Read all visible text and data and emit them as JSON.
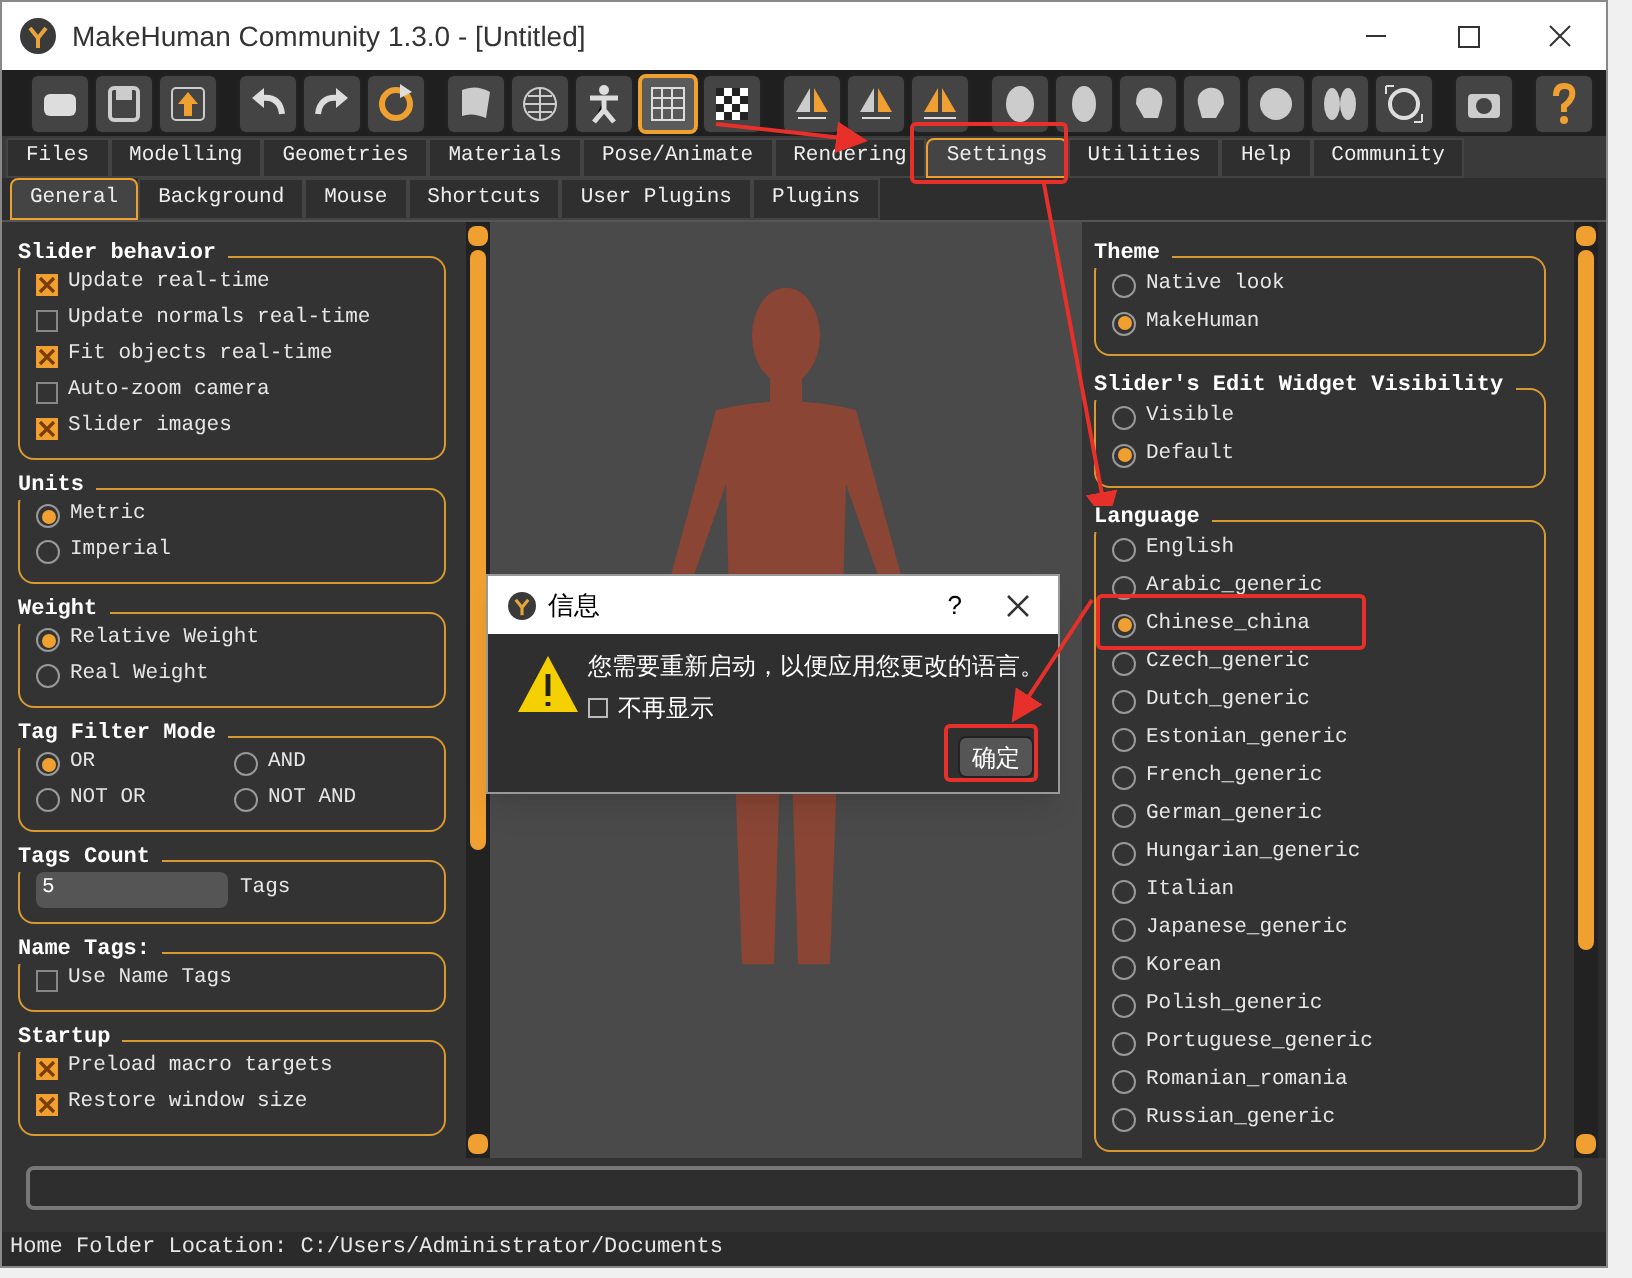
{
  "window": {
    "title": "MakeHuman Community 1.3.0 - [Untitled]"
  },
  "toolbar_buttons": [
    {
      "selected": false
    },
    {
      "selected": false
    },
    {
      "selected": false
    },
    {
      "selected": false
    },
    {
      "selected": false
    },
    {
      "selected": false
    },
    {
      "selected": false
    },
    {
      "selected": false
    },
    {
      "selected": false
    },
    {
      "selected": true
    },
    {
      "selected": false
    },
    {
      "selected": false
    },
    {
      "selected": false
    },
    {
      "selected": false
    },
    {
      "selected": false
    },
    {
      "selected": false
    },
    {
      "selected": false
    },
    {
      "selected": false
    },
    {
      "selected": false
    },
    {
      "selected": false
    },
    {
      "selected": false
    },
    {
      "selected": false
    },
    {
      "selected": false
    }
  ],
  "main_tabs": [
    {
      "label": "Files",
      "selected": false
    },
    {
      "label": "Modelling",
      "selected": false
    },
    {
      "label": "Geometries",
      "selected": false
    },
    {
      "label": "Materials",
      "selected": false
    },
    {
      "label": "Pose/Animate",
      "selected": false
    },
    {
      "label": "Rendering",
      "selected": false
    },
    {
      "label": "Settings",
      "selected": true
    },
    {
      "label": "Utilities",
      "selected": false
    },
    {
      "label": "Help",
      "selected": false
    },
    {
      "label": "Community",
      "selected": false
    }
  ],
  "sub_tabs": [
    {
      "label": "General",
      "selected": true
    },
    {
      "label": "Background",
      "selected": false
    },
    {
      "label": "Mouse",
      "selected": false
    },
    {
      "label": "Shortcuts",
      "selected": false
    },
    {
      "label": "User Plugins",
      "selected": false
    },
    {
      "label": "Plugins",
      "selected": false
    }
  ],
  "left_panel": [
    {
      "title": "Slider behavior",
      "kind": "checkbox",
      "items": [
        {
          "label": "Update real-time",
          "checked": true
        },
        {
          "label": "Update normals real-time",
          "checked": false
        },
        {
          "label": "Fit objects real-time",
          "checked": true
        },
        {
          "label": "Auto-zoom camera",
          "checked": false
        },
        {
          "label": "Slider images",
          "checked": true
        }
      ]
    },
    {
      "title": "Units",
      "kind": "radio",
      "items": [
        {
          "label": "Metric",
          "selected": true
        },
        {
          "label": "Imperial",
          "selected": false
        }
      ]
    },
    {
      "title": "Weight",
      "kind": "radio",
      "items": [
        {
          "label": "Relative Weight",
          "selected": true
        },
        {
          "label": "Real Weight",
          "selected": false
        }
      ]
    },
    {
      "title": "Tag Filter Mode",
      "kind": "radio-grid",
      "items": [
        {
          "label": "OR",
          "selected": true
        },
        {
          "label": "AND",
          "selected": false
        },
        {
          "label": "NOT OR",
          "selected": false
        },
        {
          "label": "NOT AND",
          "selected": false
        }
      ]
    },
    {
      "title": "Tags Count",
      "kind": "number",
      "value": "5",
      "unit": "Tags"
    },
    {
      "title": "Name Tags:",
      "kind": "checkbox",
      "items": [
        {
          "label": "Use Name Tags",
          "checked": false
        }
      ]
    },
    {
      "title": "Startup",
      "kind": "checkbox",
      "items": [
        {
          "label": "Preload macro targets",
          "checked": true
        },
        {
          "label": "Restore window size",
          "checked": true
        }
      ]
    }
  ],
  "right_panel": [
    {
      "title": "Theme",
      "kind": "radio",
      "items": [
        {
          "label": "Native look",
          "selected": false
        },
        {
          "label": "MakeHuman",
          "selected": true
        }
      ]
    },
    {
      "title": "Slider's Edit Widget Visibility",
      "kind": "radio",
      "items": [
        {
          "label": "Visible",
          "selected": false
        },
        {
          "label": "Default",
          "selected": true
        }
      ]
    },
    {
      "title": "Language",
      "kind": "radio",
      "items": [
        {
          "label": "English",
          "selected": false
        },
        {
          "label": "Arabic_generic",
          "selected": false
        },
        {
          "label": "Chinese_china",
          "selected": true
        },
        {
          "label": "Czech_generic",
          "selected": false
        },
        {
          "label": "Dutch_generic",
          "selected": false
        },
        {
          "label": "Estonian_generic",
          "selected": false
        },
        {
          "label": "French_generic",
          "selected": false
        },
        {
          "label": "German_generic",
          "selected": false
        },
        {
          "label": "Hungarian_generic",
          "selected": false
        },
        {
          "label": "Italian",
          "selected": false
        },
        {
          "label": "Japanese_generic",
          "selected": false
        },
        {
          "label": "Korean",
          "selected": false
        },
        {
          "label": "Polish_generic",
          "selected": false
        },
        {
          "label": "Portuguese_generic",
          "selected": false
        },
        {
          "label": "Romanian_romania",
          "selected": false
        },
        {
          "label": "Russian_generic",
          "selected": false
        }
      ]
    }
  ],
  "dialog": {
    "title": "信息",
    "help": "?",
    "message": "您需要重新启动，以便应用您更改的语言。",
    "checkbox": {
      "label": "不再显示",
      "checked": false
    },
    "ok_button": "确定"
  },
  "progress": {
    "level": 0
  },
  "status_bar": {
    "text": "Home Folder Location: C:/Users/Administrator/Documents"
  }
}
